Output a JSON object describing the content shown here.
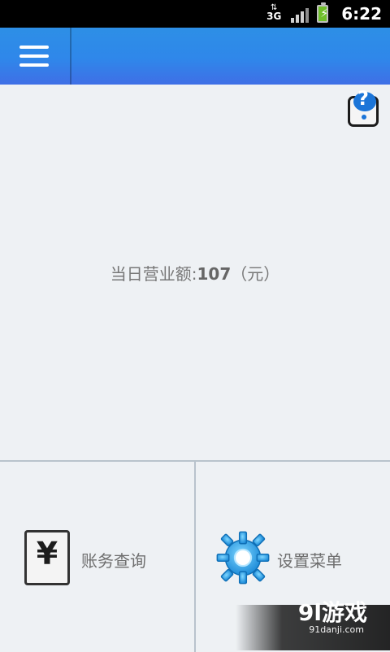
{
  "status_bar": {
    "network_type": "3G",
    "time": "6:22"
  },
  "app_bar": {
    "menu_icon": "hamburger-menu-icon"
  },
  "main": {
    "help_icon": "help-icon",
    "revenue_label": "当日营业额:",
    "revenue_value": "107",
    "revenue_unit": "（元）"
  },
  "bottom_tiles": [
    {
      "label": "账务查询",
      "icon": "receipt-yen-icon"
    },
    {
      "label": "设置菜单",
      "icon": "gear-icon"
    }
  ],
  "watermark": {
    "title": "9l游戏",
    "url": "91danji.com"
  },
  "colors": {
    "appbar": "#2f87ea",
    "background": "#eef1f4",
    "divider": "#b9c3cc",
    "gear": "#2aa7ea"
  }
}
